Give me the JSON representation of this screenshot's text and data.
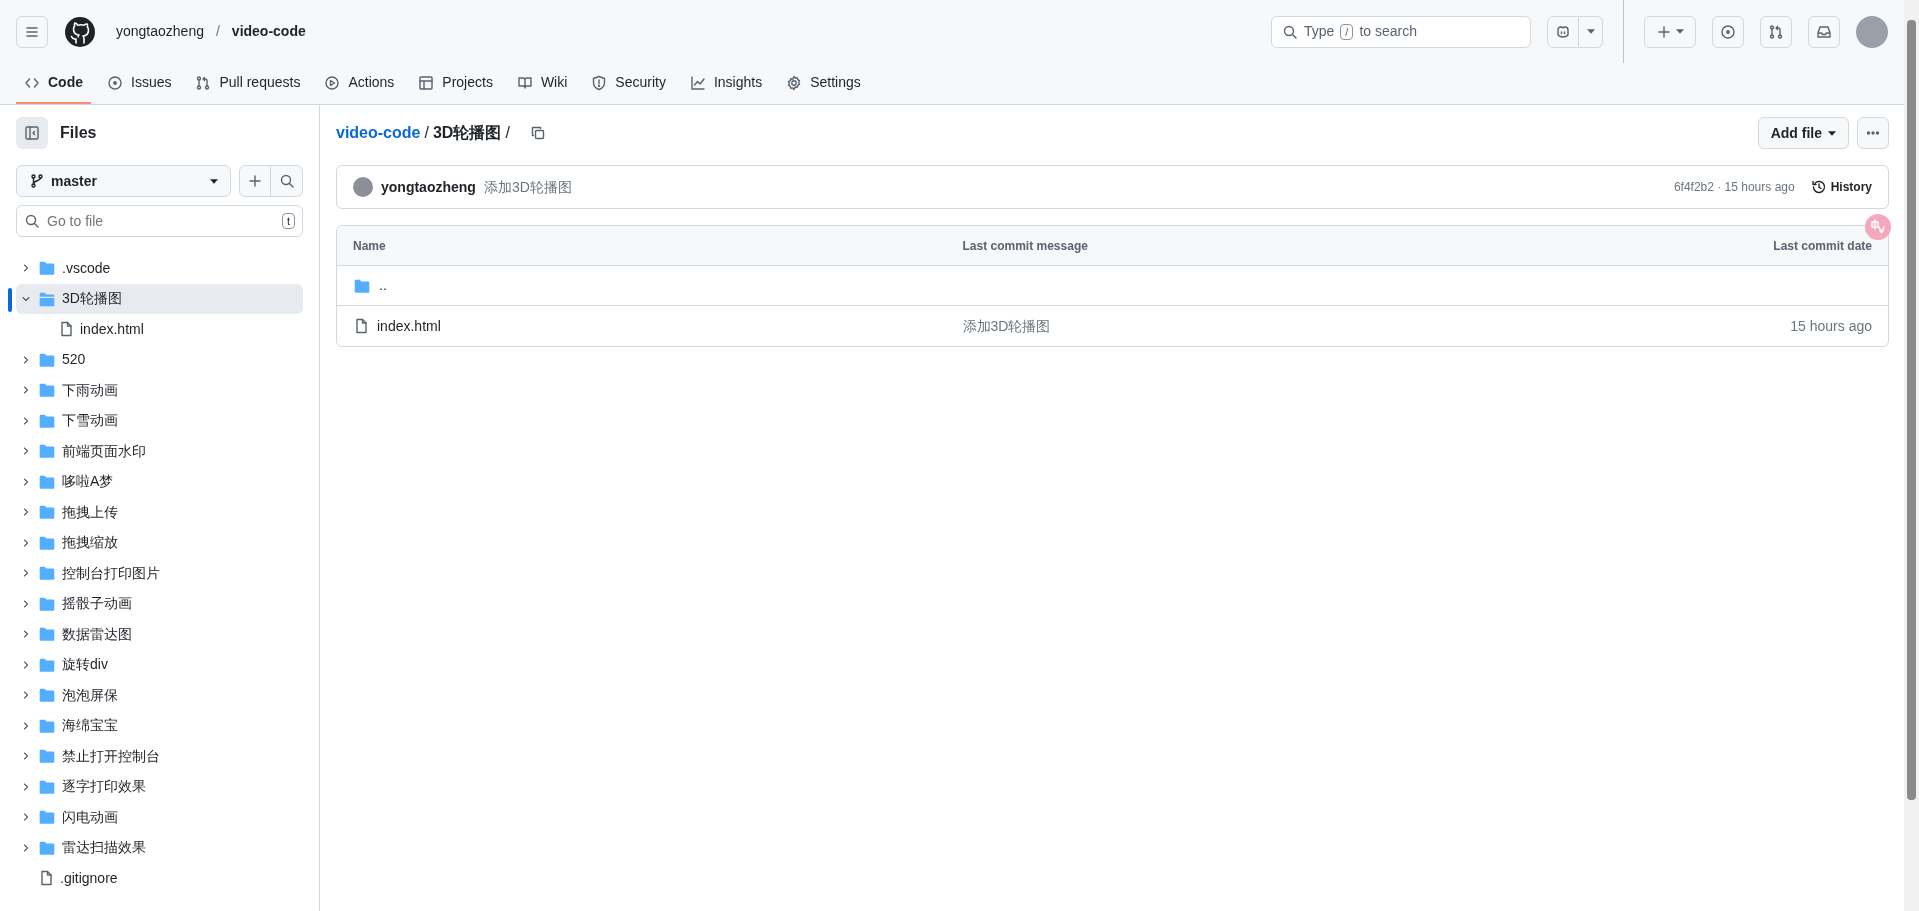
{
  "header": {
    "owner": "yongtaozheng",
    "separator": "/",
    "repo": "video-code",
    "search": {
      "before": "Type",
      "key": "/",
      "after": "to search"
    }
  },
  "repo_tabs": [
    {
      "label": "Code",
      "kind": "code",
      "selected": true
    },
    {
      "label": "Issues",
      "kind": "issues",
      "selected": false
    },
    {
      "label": "Pull requests",
      "kind": "pulls",
      "selected": false
    },
    {
      "label": "Actions",
      "kind": "actions",
      "selected": false
    },
    {
      "label": "Projects",
      "kind": "projects",
      "selected": false
    },
    {
      "label": "Wiki",
      "kind": "wiki",
      "selected": false
    },
    {
      "label": "Security",
      "kind": "security",
      "selected": false
    },
    {
      "label": "Insights",
      "kind": "insights",
      "selected": false
    },
    {
      "label": "Settings",
      "kind": "settings",
      "selected": false
    }
  ],
  "sidebar": {
    "title": "Files",
    "branch": "master",
    "filter": {
      "placeholder": "Go to file",
      "shortcut": "t"
    },
    "tree": [
      {
        "kind": "folder",
        "name": ".vscode",
        "expanded": false,
        "selected": false
      },
      {
        "kind": "folder",
        "name": "3D轮播图",
        "expanded": true,
        "selected": true,
        "children": [
          {
            "kind": "file",
            "name": "index.html",
            "selected": false
          }
        ]
      },
      {
        "kind": "folder",
        "name": "520",
        "expanded": false,
        "selected": false
      },
      {
        "kind": "folder",
        "name": "下雨动画",
        "expanded": false,
        "selected": false
      },
      {
        "kind": "folder",
        "name": "下雪动画",
        "expanded": false,
        "selected": false
      },
      {
        "kind": "folder",
        "name": "前端页面水印",
        "expanded": false,
        "selected": false
      },
      {
        "kind": "folder",
        "name": "哆啦A梦",
        "expanded": false,
        "selected": false
      },
      {
        "kind": "folder",
        "name": "拖拽上传",
        "expanded": false,
        "selected": false
      },
      {
        "kind": "folder",
        "name": "拖拽缩放",
        "expanded": false,
        "selected": false
      },
      {
        "kind": "folder",
        "name": "控制台打印图片",
        "expanded": false,
        "selected": false
      },
      {
        "kind": "folder",
        "name": "摇骰子动画",
        "expanded": false,
        "selected": false
      },
      {
        "kind": "folder",
        "name": "数据雷达图",
        "expanded": false,
        "selected": false
      },
      {
        "kind": "folder",
        "name": "旋转div",
        "expanded": false,
        "selected": false
      },
      {
        "kind": "folder",
        "name": "泡泡屏保",
        "expanded": false,
        "selected": false
      },
      {
        "kind": "folder",
        "name": "海绵宝宝",
        "expanded": false,
        "selected": false
      },
      {
        "kind": "folder",
        "name": "禁止打开控制台",
        "expanded": false,
        "selected": false
      },
      {
        "kind": "folder",
        "name": "逐字打印效果",
        "expanded": false,
        "selected": false
      },
      {
        "kind": "folder",
        "name": "闪电动画",
        "expanded": false,
        "selected": false
      },
      {
        "kind": "folder",
        "name": "雷达扫描效果",
        "expanded": false,
        "selected": false
      },
      {
        "kind": "file",
        "name": ".gitignore",
        "selected": false
      }
    ]
  },
  "breadcrumb": {
    "repo": "video-code",
    "separator": "/",
    "folder": "3D轮播图",
    "trailing": "/"
  },
  "add_file_button": "Add file",
  "latest_commit": {
    "author": "yongtaozheng",
    "message": "添加3D轮播图",
    "meta": "6f4f2b2 · 15 hours ago",
    "history": "History"
  },
  "table": {
    "columns": [
      "Name",
      "Last commit message",
      "Last commit date"
    ],
    "rows": [
      {
        "kind": "parent",
        "name": ".."
      },
      {
        "kind": "file",
        "name": "index.html",
        "message": "添加3D轮播图",
        "date": "15 hours ago"
      }
    ]
  }
}
